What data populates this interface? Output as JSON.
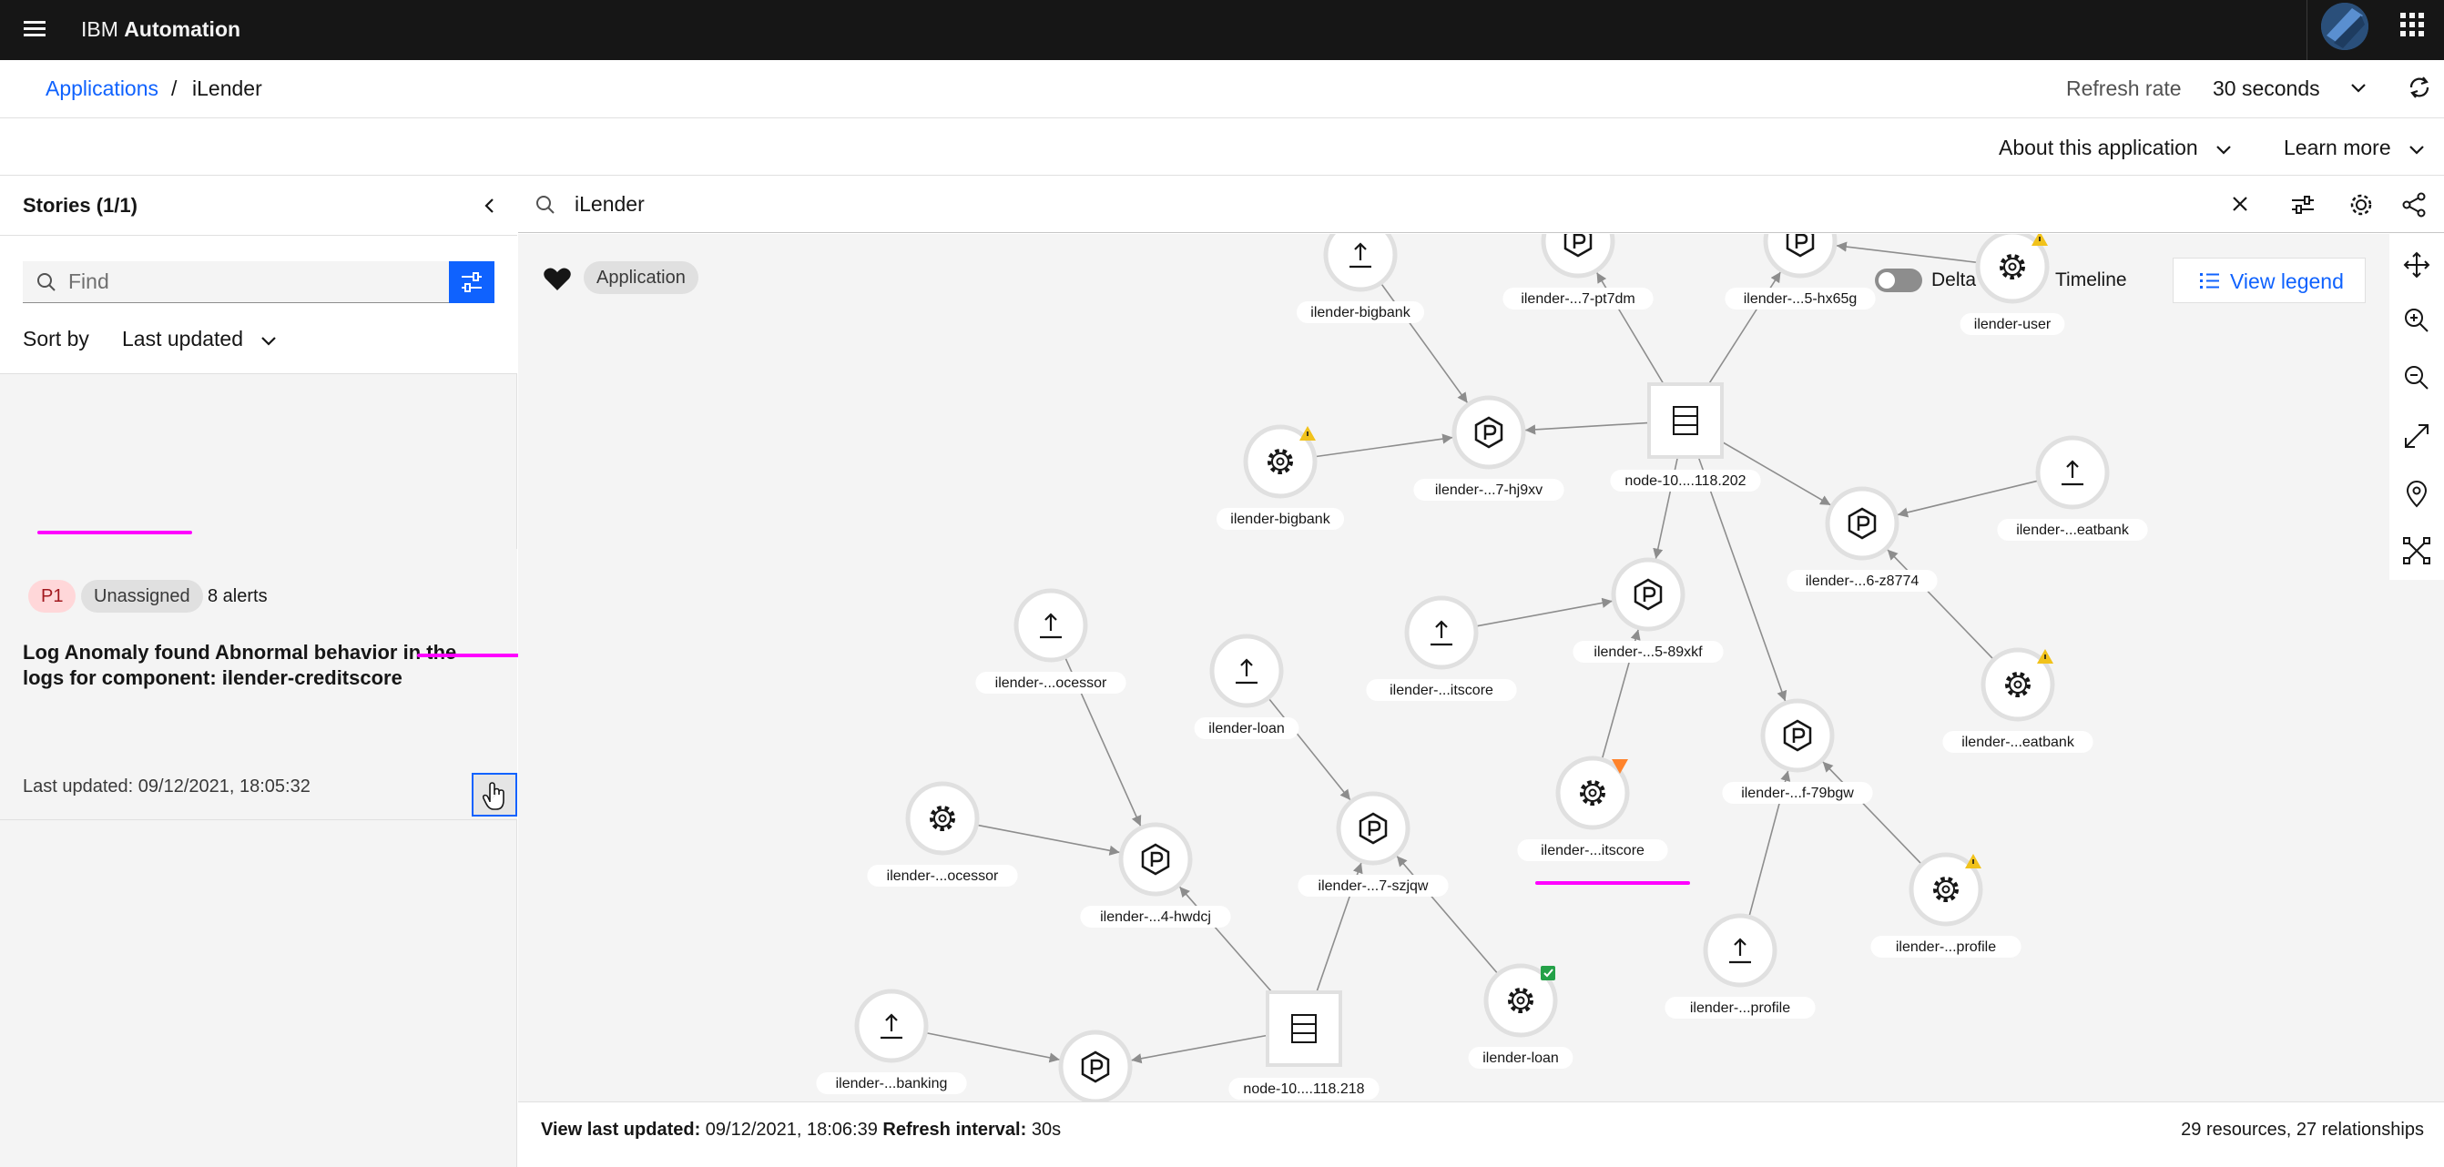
{
  "shell": {
    "brand_ibm": "IBM",
    "brand_product": "Automation"
  },
  "breadcrumb": {
    "parent": "Applications",
    "separator": "/",
    "current": "iLender"
  },
  "refresh": {
    "label": "Refresh rate",
    "value": "30 seconds"
  },
  "actions": {
    "about": "About this application",
    "learn": "Learn more"
  },
  "stories": {
    "title": "Stories (1/1)",
    "find_placeholder": "Find",
    "sort_label": "Sort by",
    "sort_value": "Last updated",
    "items": [
      {
        "priority": "P1",
        "owner": "Unassigned",
        "alerts": "8 alerts",
        "title": "Log Anomaly found Abnormal behavior in the logs for component: ilender-creditscore",
        "updated": "Last updated: 09/12/2021, 18:05:32"
      }
    ]
  },
  "topology": {
    "search_value": "iLender",
    "app_tag": "Application",
    "delta_label": "Delta",
    "timeline_label": "Timeline",
    "legend_label": "View legend",
    "status": {
      "last_updated_label": "View last updated:",
      "last_updated_value": "09/12/2021, 18:06:39",
      "refresh_label": "Refresh interval:",
      "refresh_value": "30s",
      "summary": "29 resources, 27 relationships"
    },
    "nodes": [
      {
        "id": "n1",
        "type": "upload",
        "label": "ilender-bigbank"
      },
      {
        "id": "n2",
        "type": "pod",
        "label": "ilender-...7-pt7dm"
      },
      {
        "id": "n3",
        "type": "pod",
        "label": "ilender-...5-hx65g"
      },
      {
        "id": "n4",
        "type": "service",
        "label": "ilender-user",
        "status": "warning"
      },
      {
        "id": "n5",
        "type": "service",
        "label": "ilender-bigbank",
        "status": "warning"
      },
      {
        "id": "n6",
        "type": "pod",
        "label": "ilender-...7-hj9xv"
      },
      {
        "id": "n7",
        "type": "server",
        "label": "node-10....118.202"
      },
      {
        "id": "n8",
        "type": "upload",
        "label": "ilender-...eatbank"
      },
      {
        "id": "n9",
        "type": "pod",
        "label": "ilender-...6-z8774"
      },
      {
        "id": "n10",
        "type": "upload",
        "label": "ilender-...ocessor"
      },
      {
        "id": "n11",
        "type": "upload",
        "label": "ilender-loan"
      },
      {
        "id": "n12",
        "type": "upload",
        "label": "ilender-...itscore"
      },
      {
        "id": "n13",
        "type": "pod",
        "label": "ilender-...5-89xkf"
      },
      {
        "id": "n14",
        "type": "service",
        "label": "ilender-...eatbank",
        "status": "warning"
      },
      {
        "id": "n15",
        "type": "pod",
        "label": "ilender-...f-79bgw"
      },
      {
        "id": "n16",
        "type": "service",
        "label": "ilender-...ocessor"
      },
      {
        "id": "n17",
        "type": "pod",
        "label": "ilender-...4-hwdcj"
      },
      {
        "id": "n18",
        "type": "pod",
        "label": "ilender-...7-szjqw"
      },
      {
        "id": "n19",
        "type": "service",
        "label": "ilender-...itscore",
        "status": "minor"
      },
      {
        "id": "n20",
        "type": "service",
        "label": "ilender-...profile",
        "status": "warning"
      },
      {
        "id": "n21",
        "type": "upload",
        "label": "ilender-...profile"
      },
      {
        "id": "n22",
        "type": "upload",
        "label": "ilender-...banking"
      },
      {
        "id": "n23",
        "type": "pod",
        "label": ""
      },
      {
        "id": "n24",
        "type": "server",
        "label": "node-10....118.218"
      },
      {
        "id": "n25",
        "type": "service",
        "label": "ilender-loan",
        "status": "ok"
      }
    ],
    "edges": [
      [
        "n1",
        "n6"
      ],
      [
        "n5",
        "n6"
      ],
      [
        "n7",
        "n6"
      ],
      [
        "n7",
        "n2"
      ],
      [
        "n7",
        "n3"
      ],
      [
        "n4",
        "n3"
      ],
      [
        "n7",
        "n9"
      ],
      [
        "n8",
        "n9"
      ],
      [
        "n14",
        "n9"
      ],
      [
        "n7",
        "n13"
      ],
      [
        "n12",
        "n13"
      ],
      [
        "n19",
        "n13"
      ],
      [
        "n7",
        "n15"
      ],
      [
        "n20",
        "n15"
      ],
      [
        "n21",
        "n15"
      ],
      [
        "n10",
        "n17"
      ],
      [
        "n16",
        "n17"
      ],
      [
        "n24",
        "n17"
      ],
      [
        "n11",
        "n18"
      ],
      [
        "n24",
        "n18"
      ],
      [
        "n25",
        "n18"
      ],
      [
        "n24",
        "n23"
      ],
      [
        "n22",
        "n23"
      ]
    ]
  }
}
